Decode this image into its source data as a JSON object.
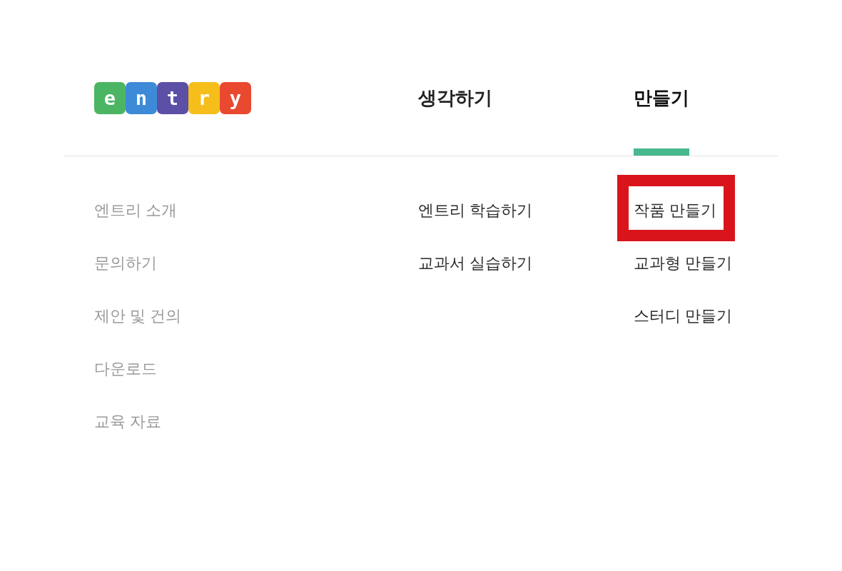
{
  "logo": {
    "letters": [
      {
        "letter": "e",
        "color": "#4bb563"
      },
      {
        "letter": "n",
        "color": "#3d8bd8"
      },
      {
        "letter": "t",
        "color": "#5b4fa6"
      },
      {
        "letter": "r",
        "color": "#f5be1b"
      },
      {
        "letter": "y",
        "color": "#e9492f"
      }
    ]
  },
  "nav_tabs": [
    {
      "label": "생각하기",
      "selected": false
    },
    {
      "label": "만들기",
      "selected": true
    }
  ],
  "menu_columns": [
    {
      "muted": true,
      "items": [
        {
          "label": "엔트리 소개",
          "highlighted": false
        },
        {
          "label": "문의하기",
          "highlighted": false
        },
        {
          "label": "제안 및 건의",
          "highlighted": false
        },
        {
          "label": "다운로드",
          "highlighted": false
        },
        {
          "label": "교육 자료",
          "highlighted": false
        }
      ]
    },
    {
      "muted": false,
      "items": [
        {
          "label": "엔트리 학습하기",
          "highlighted": false
        },
        {
          "label": "교과서 실습하기",
          "highlighted": false
        }
      ]
    },
    {
      "muted": false,
      "items": [
        {
          "label": "작품 만들기",
          "highlighted": true
        },
        {
          "label": "교과형 만들기",
          "highlighted": false
        },
        {
          "label": "스터디 만들기",
          "highlighted": false
        }
      ]
    }
  ]
}
